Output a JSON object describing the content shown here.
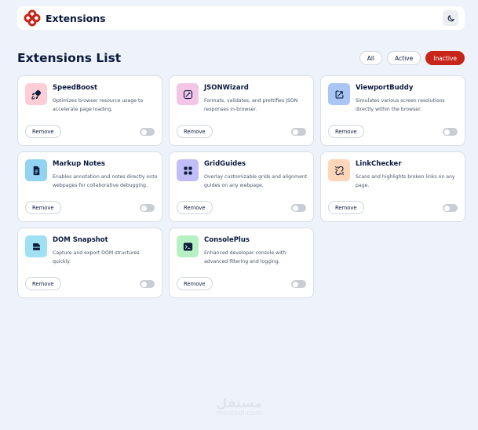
{
  "header": {
    "brand_name": "Extensions",
    "logo_icon": "extensions-logo-icon",
    "theme_icon": "moon-icon",
    "accent_color": "#c7241a"
  },
  "main": {
    "title": "Extensions List",
    "filters": [
      {
        "label": "All",
        "active": false
      },
      {
        "label": "Active",
        "active": false
      },
      {
        "label": "Inactive",
        "active": true
      }
    ]
  },
  "extensions": [
    {
      "name": "SpeedBoost",
      "description": "Optimizes browser resource usage to accelerate page loading.",
      "icon": "rocket-icon",
      "icon_bg": "#fecdd6",
      "remove_label": "Remove",
      "enabled": false
    },
    {
      "name": "JSONWizard",
      "description": "Formats, validates, and prettifies JSON responses in-browser.",
      "icon": "wand-icon",
      "icon_bg": "#f3c6e8",
      "remove_label": "Remove",
      "enabled": false
    },
    {
      "name": "ViewportBuddy",
      "description": "Simulates various screen resolutions directly within the browser.",
      "icon": "resize-icon",
      "icon_bg": "#a9c6f4",
      "remove_label": "Remove",
      "enabled": false
    },
    {
      "name": "Markup Notes",
      "description": "Enables annotation and notes directly onto webpages for collaborative debugging.",
      "icon": "note-icon",
      "icon_bg": "#93d3f2",
      "remove_label": "Remove",
      "enabled": false
    },
    {
      "name": "GridGuides",
      "description": "Overlay customizable grids and alignment guides on any webpage.",
      "icon": "grid-icon",
      "icon_bg": "#c1bdf7",
      "remove_label": "Remove",
      "enabled": false
    },
    {
      "name": "LinkChecker",
      "description": "Scans and highlights broken links on any page.",
      "icon": "broken-link-icon",
      "icon_bg": "#fdd6b8",
      "remove_label": "Remove",
      "enabled": false
    },
    {
      "name": "DOM Snapshot",
      "description": "Capture and export DOM structures quickly.",
      "icon": "snapshot-icon",
      "icon_bg": "#9fe0f3",
      "remove_label": "Remove",
      "enabled": false
    },
    {
      "name": "ConsolePlus",
      "description": "Enhanced developer console with advanced filtering and logging.",
      "icon": "terminal-icon",
      "icon_bg": "#b6f1c4",
      "remove_label": "Remove",
      "enabled": false
    }
  ],
  "watermark": {
    "arabic": "مستقل",
    "latin": "mostaql.com"
  }
}
